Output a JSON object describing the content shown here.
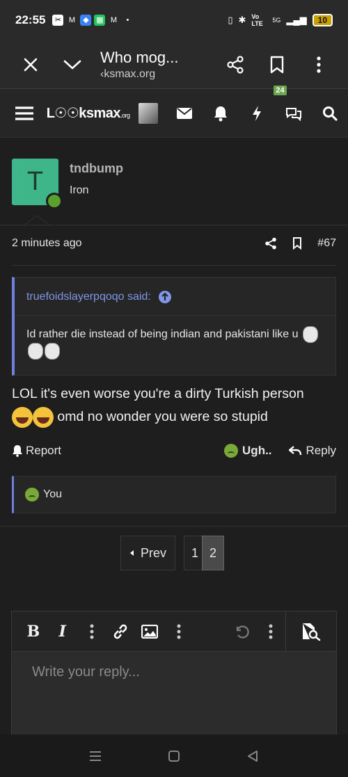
{
  "status": {
    "time": "22:55",
    "network": "5G",
    "volte": "Vo LTE",
    "battery": "10"
  },
  "browser": {
    "title": "Who mog...",
    "url": "‹ksmax.org"
  },
  "site": {
    "logo": "L☉☉ksmax",
    "logo_suffix": ".org",
    "chat_badge": "24"
  },
  "post": {
    "username": "tndbump",
    "rank": "Iron",
    "avatar_letter": "T",
    "time_ago": "2 minutes ago",
    "post_number": "#67",
    "quote_author": "truefoidslayerpqoqo said:",
    "quote_text": "Id rather die instead of being indian and pakistani like u",
    "body_line1": "LOL it's even worse you're a dirty Turkish person",
    "body_line2": "omd no wonder you were so stupid",
    "report_label": "Report",
    "reaction_label": "Ugh..",
    "reply_label": "Reply",
    "reacted_by": "You"
  },
  "pagination": {
    "prev_label": "Prev",
    "pages": [
      "1",
      "2"
    ],
    "current": "2"
  },
  "editor": {
    "placeholder": "Write your reply..."
  },
  "colors": {
    "accent": "#6f7fdc",
    "avatar_bg": "#3fb58a",
    "online": "#5aa02c",
    "badge": "#6aa84f"
  }
}
